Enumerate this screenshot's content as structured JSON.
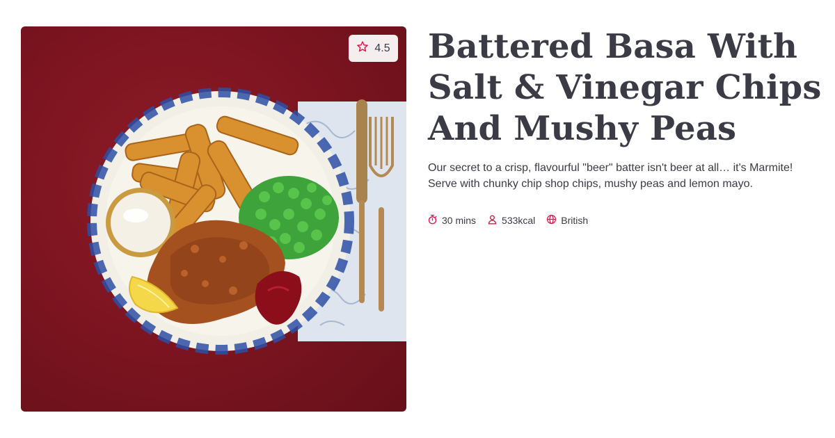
{
  "recipe": {
    "rating": "4.5",
    "title": "Battered Basa With Salt & Vinegar Chips And Mushy Peas",
    "description": "Our secret to a crisp, flavourful \"beer\" batter isn't beer at all… it's Marmite! Serve with chunky chip shop chips, mushy peas and lemon mayo.",
    "meta": {
      "time": "30 mins",
      "calories": "533kcal",
      "cuisine": "British"
    }
  },
  "icons": {
    "rating": "star-icon",
    "time": "stopwatch-icon",
    "calories": "person-icon",
    "cuisine": "globe-icon"
  },
  "colors": {
    "accent": "#e0174a",
    "text": "#3b3b46",
    "photo_background": "#7a141f"
  }
}
